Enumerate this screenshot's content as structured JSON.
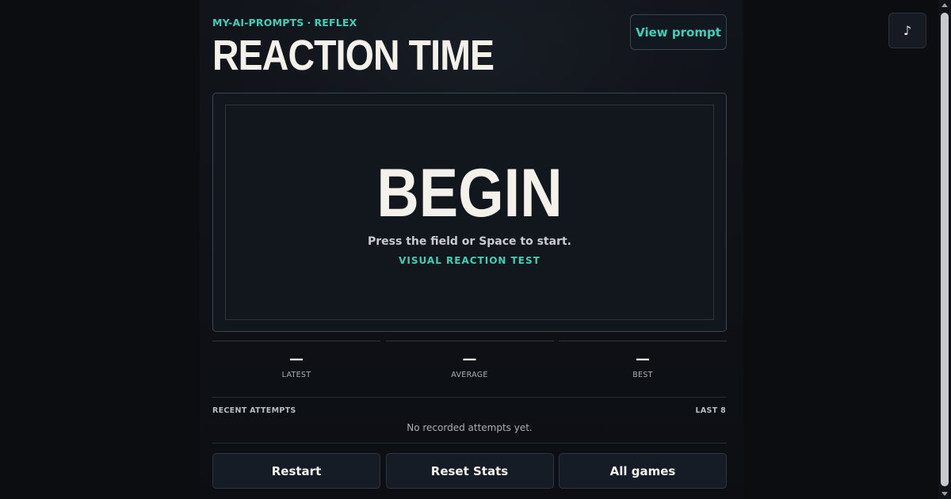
{
  "header": {
    "breadcrumb_parent": "MY-AI-PROMPTS",
    "breadcrumb_separator": "·",
    "breadcrumb_current": "REFLEX",
    "title": "REACTION TIME",
    "view_prompt_label": "View prompt",
    "music_icon": "♪"
  },
  "field": {
    "heading": "BEGIN",
    "hint": "Press the field or Space to start.",
    "mode": "VISUAL REACTION TEST"
  },
  "stats": [
    {
      "value": "—",
      "label": "LATEST"
    },
    {
      "value": "—",
      "label": "AVERAGE"
    },
    {
      "value": "—",
      "label": "BEST"
    }
  ],
  "recent": {
    "label": "RECENT ATTEMPTS",
    "range_label": "LAST 8",
    "empty_text": "No recorded attempts yet."
  },
  "actions": {
    "restart": "Restart",
    "reset_stats": "Reset Stats",
    "all_games": "All games"
  },
  "colors": {
    "accent": "#3fd0b8",
    "background": "#0b0d11",
    "text": "#f4f1ea"
  }
}
